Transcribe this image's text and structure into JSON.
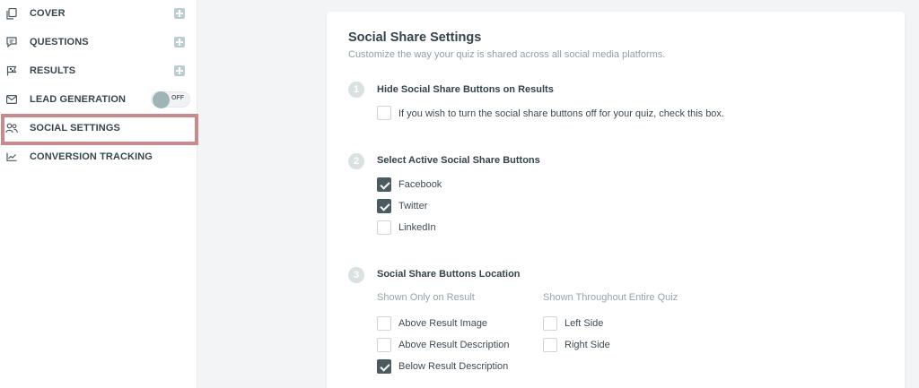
{
  "sidebar": {
    "items": [
      {
        "label": "COVER",
        "icon": "copy-icon",
        "action": "add"
      },
      {
        "label": "QUESTIONS",
        "icon": "message-icon",
        "action": "add"
      },
      {
        "label": "RESULTS",
        "icon": "flag-icon",
        "action": "add"
      },
      {
        "label": "LEAD GENERATION",
        "icon": "mail-icon",
        "action": "toggle",
        "toggle_label": "OFF",
        "toggle_on": false
      },
      {
        "label": "SOCIAL SETTINGS",
        "icon": "users-icon",
        "active": true
      },
      {
        "label": "CONVERSION TRACKING",
        "icon": "chart-line-icon"
      }
    ],
    "highlight_color": "#c98a8d"
  },
  "main": {
    "title": "Social Share Settings",
    "subtitle": "Customize the way your quiz is shared across all social media platforms.",
    "steps": [
      {
        "number": "1",
        "title": "Hide Social Share Buttons on Results",
        "options": [
          {
            "label": "If you wish to turn the social share buttons off for your quiz, check this box.",
            "checked": false
          }
        ]
      },
      {
        "number": "2",
        "title": "Select Active Social Share Buttons",
        "options": [
          {
            "label": "Facebook",
            "checked": true
          },
          {
            "label": "Twitter",
            "checked": true
          },
          {
            "label": "LinkedIn",
            "checked": false
          }
        ]
      },
      {
        "number": "3",
        "title": "Social Share Buttons Location",
        "columns": [
          {
            "heading": "Shown Only on Result",
            "options": [
              {
                "label": "Above Result Image",
                "checked": false
              },
              {
                "label": "Above Result Description",
                "checked": false
              },
              {
                "label": "Below Result Description",
                "checked": true
              }
            ]
          },
          {
            "heading": "Shown Throughout Entire Quiz",
            "options": [
              {
                "label": "Left Side",
                "checked": false
              },
              {
                "label": "Right Side",
                "checked": false
              }
            ]
          }
        ]
      }
    ]
  },
  "colors": {
    "accent": "#4a5b62",
    "step_badge": "#d8e2e2",
    "plus_badge": "#b9cfcf"
  }
}
